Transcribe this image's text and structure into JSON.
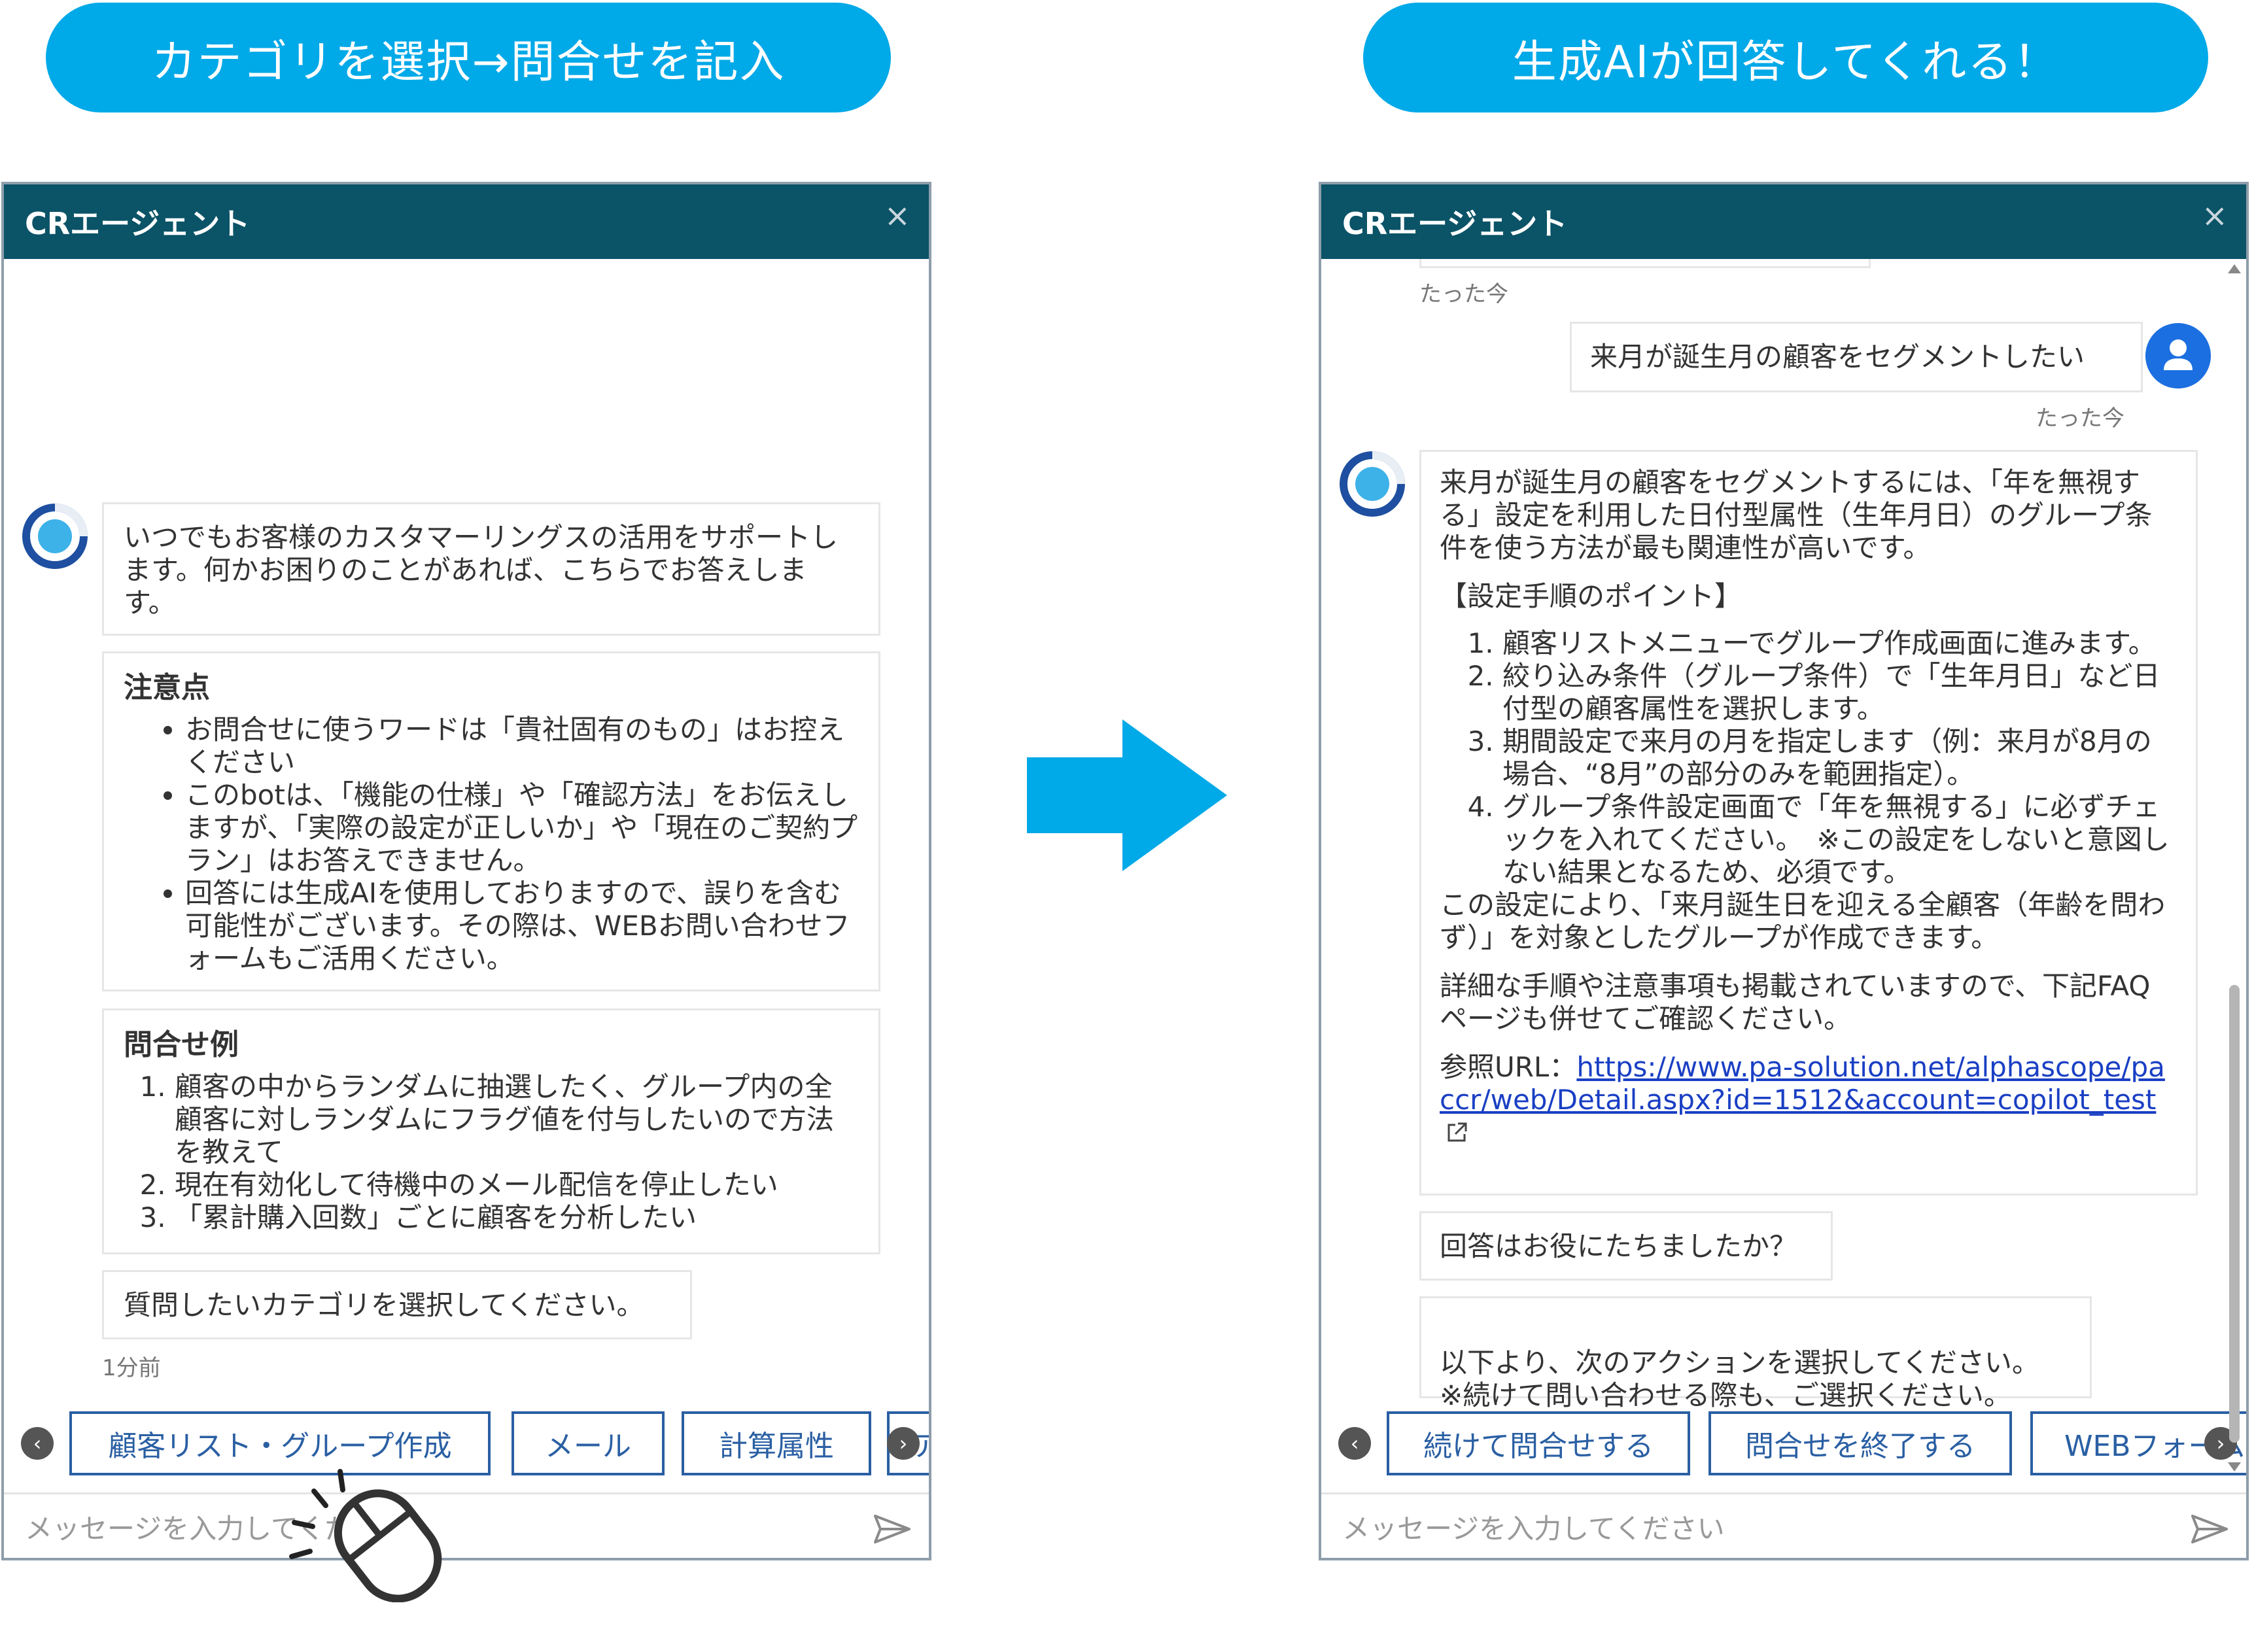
{
  "banners": {
    "left": "カテゴリを選択→問合せを記入",
    "right": "生成AIが回答してくれる！"
  },
  "left_window": {
    "title": "CRエージェント",
    "close": "×",
    "intro": "いつでもお客様のカスタマーリングスの活用をサポートします。何かお困りのことがあれば、こちらでお答えします。",
    "notes": {
      "heading": "注意点",
      "items": [
        "お問合せに使うワードは「貴社固有のもの」はお控えください",
        "このbotは、「機能の仕様」や「確認方法」をお伝えしますが、「実際の設定が正しいか」や「現在のご契約プラン」はお答えできません。",
        "回答には生成AIを使用しておりますので、誤りを含む可能性がございます。その際は、WEBお問い合わせフォームもご活用ください。"
      ]
    },
    "examples": {
      "heading": "問合せ例",
      "items": [
        "顧客の中からランダムに抽選したく、グループ内の全顧客に対しランダムにフラグ値を付与したいので方法を教えて",
        "現在有効化して待機中のメール配信を停止したい",
        "「累計購入回数」ごとに顧客を分析したい"
      ]
    },
    "prompt": "質問したいカテゴリを選択してください。",
    "timestamp": "1分前",
    "chips": [
      "顧客リスト・グループ作成",
      "メール",
      "計算属性",
      "ア"
    ],
    "input_placeholder": "メッセージを入力してください"
  },
  "right_window": {
    "title": "CRエージェント",
    "close": "×",
    "ts_top": "たった今",
    "user_message": "来月が誕生月の顧客をセグメントしたい",
    "ts_user": "たった今",
    "answer": {
      "intro": "来月が誕生月の顧客をセグメントするには、「年を無視する」設定を利用した日付型属性（生年月日）のグループ条件を使う方法が最も関連性が高いです。",
      "points_heading": "【設定手順のポイント】",
      "steps": [
        "顧客リストメニューでグループ作成画面に進みます。",
        "絞り込み条件（グループ条件）で「生年月日」など日付型の顧客属性を選択します。",
        "期間設定で来月の月を指定します（例：来月が8月の場合、“8月”の部分のみを範囲指定）。",
        "グループ条件設定画面で「年を無視する」に必ずチェックを入れてください。　※この設定をしないと意図しない結果となるため、必須です。"
      ],
      "summary": "この設定により、「来月誕生日を迎える全顧客（年齢を問わず）」を対象としたグループが作成できます。",
      "faq_note": "詳細な手順や注意事項も掲載されていますので、下記FAQページも併せてご確認ください。",
      "ref_label": "参照URL：",
      "ref_url": "https://www.pa-solution.net/alphascope/paccr/web/Detail.aspx?id=1512&account=copilot_test"
    },
    "helpful": "回答はお役にたちましたか？",
    "next_action": "以下より、次のアクションを選択してください。\n※続けて問い合わせる際も、ご選択ください。",
    "chips": [
      "続けて問合せする",
      "問合せを終了する",
      "WEBフォームよ"
    ],
    "input_placeholder": "メッセージを入力してください"
  },
  "colors": {
    "banner": "#00a9e8",
    "header": "#0b5367",
    "chip_border": "#2a5fa3",
    "user_avatar": "#1c6fe0"
  }
}
